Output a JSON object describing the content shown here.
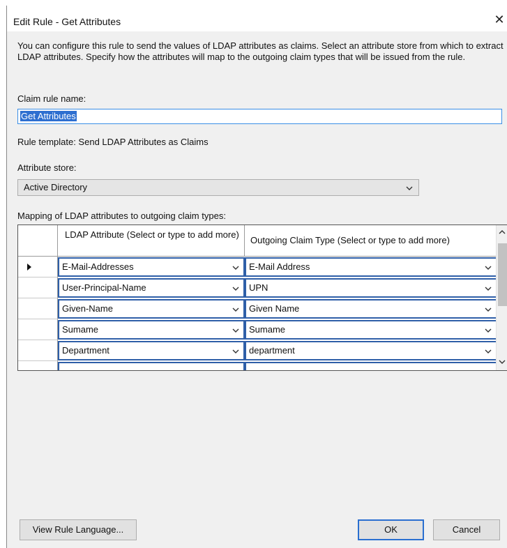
{
  "dialog": {
    "title": "Edit Rule - Get Attributes",
    "close_glyph": "✕",
    "description": "You can configure this rule to send the values of LDAP attributes as claims. Select an attribute store from which to extract LDAP attributes. Specify how the attributes will map to the outgoing claim types that will be issued from the rule."
  },
  "claim_rule": {
    "label": "Claim rule name:",
    "value": "Get Attributes"
  },
  "rule_template": "Rule template: Send LDAP Attributes as Claims",
  "attribute_store": {
    "label": "Attribute store:",
    "selected": "Active Directory"
  },
  "mapping": {
    "label": "Mapping of LDAP attributes to outgoing claim types:",
    "columns": [
      "LDAP Attribute (Select or type to add more)",
      "Outgoing Claim Type (Select or type to add more)"
    ],
    "rows": [
      {
        "ldap": "E-Mail-Addresses",
        "claim": "E-Mail Address",
        "current": true
      },
      {
        "ldap": "User-Principal-Name",
        "claim": "UPN",
        "current": false
      },
      {
        "ldap": "Given-Name",
        "claim": "Given Name",
        "current": false
      },
      {
        "ldap": "Sumame",
        "claim": "Sumame",
        "current": false
      },
      {
        "ldap": "Department",
        "claim": "department",
        "current": false
      }
    ]
  },
  "buttons": {
    "view_rule_language": "View Rule Language...",
    "ok": "OK",
    "cancel": "Cancel"
  },
  "colors": {
    "focus_border": "#2f5fa8",
    "selection": "#2e6fd0",
    "dialog_bg": "#f0f0f0"
  }
}
